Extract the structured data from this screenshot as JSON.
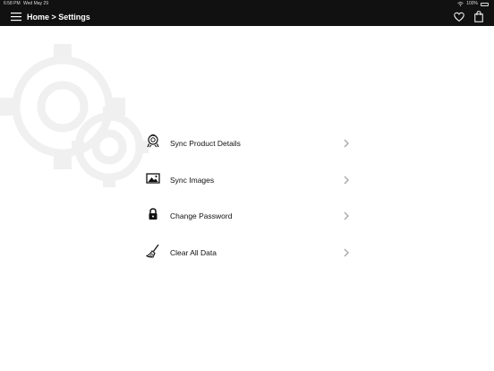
{
  "status_bar": {
    "time": "6:58 PM",
    "date": "Wed May 29",
    "battery": "100%"
  },
  "nav": {
    "home_label": "Home >",
    "current_label": "Settings"
  },
  "settings": {
    "items": [
      {
        "label": "Sync Product Details",
        "icon": "sync-product-icon"
      },
      {
        "label": "Sync Images",
        "icon": "image-icon"
      },
      {
        "label": "Change Password",
        "icon": "lock-icon"
      },
      {
        "label": "Clear All Data",
        "icon": "broom-icon"
      }
    ]
  },
  "colors": {
    "header_bg": "#111111",
    "chevron": "#a8a8a8",
    "gear_watermark": "#f0f0f0"
  }
}
